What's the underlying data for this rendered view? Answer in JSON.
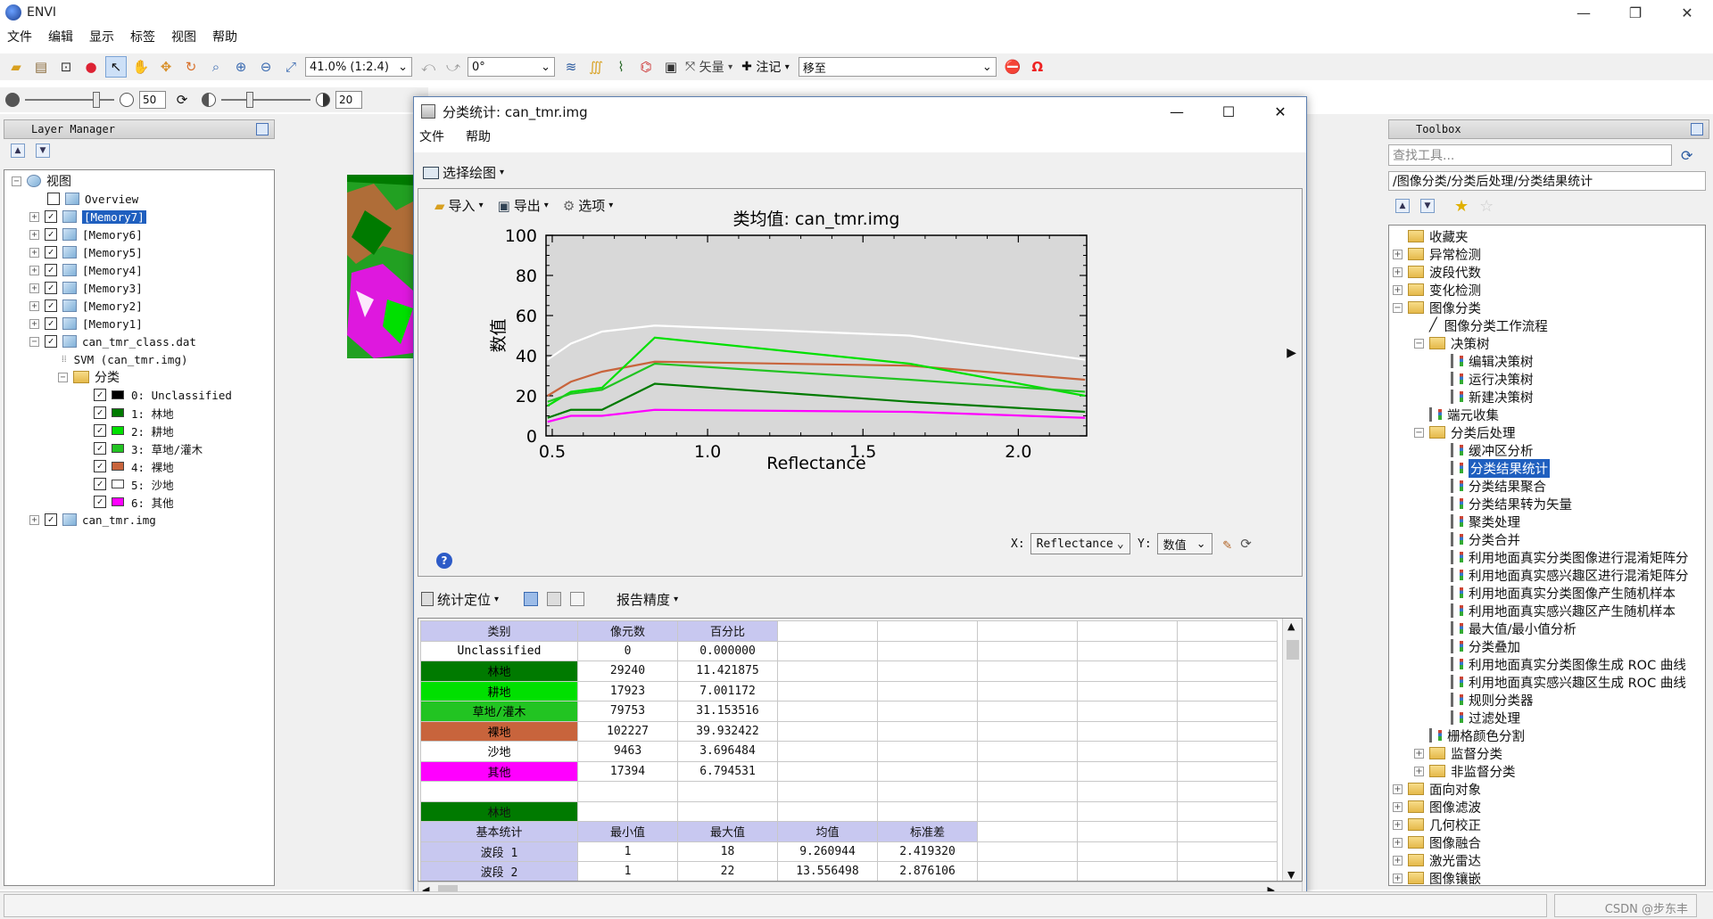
{
  "app": {
    "title": "ENVI",
    "menu": [
      "文件",
      "编辑",
      "显示",
      "标签",
      "视图",
      "帮助"
    ]
  },
  "toolbar": {
    "zoom": "41.0% (1:2.4)",
    "rotation": "0°",
    "vector_label": "矢量",
    "annotate_label": "注记",
    "goto_value": "移至",
    "brightness": "50",
    "contrast": "20"
  },
  "layer_manager": {
    "title": "Layer Manager",
    "root": "视图",
    "items": [
      {
        "label": "Overview",
        "checked": false
      },
      {
        "label": "[Memory7]",
        "checked": true,
        "selected": true
      },
      {
        "label": "[Memory6]",
        "checked": true
      },
      {
        "label": "[Memory5]",
        "checked": true
      },
      {
        "label": "[Memory4]",
        "checked": true
      },
      {
        "label": "[Memory3]",
        "checked": true
      },
      {
        "label": "[Memory2]",
        "checked": true
      },
      {
        "label": "[Memory1]",
        "checked": true
      },
      {
        "label": "can_tmr_class.dat",
        "checked": true
      }
    ],
    "svm_label": "SVM (can_tmr.img)",
    "class_folder": "分类",
    "classes": [
      {
        "label": "0: Unclassified",
        "color": "#000000"
      },
      {
        "label": "1: 林地",
        "color": "#007a00"
      },
      {
        "label": "2: 耕地",
        "color": "#00e000"
      },
      {
        "label": "3: 草地/灌木",
        "color": "#22c422"
      },
      {
        "label": "4: 裸地",
        "color": "#c8643c"
      },
      {
        "label": "5: 沙地",
        "color": "#ffffff"
      },
      {
        "label": "6: 其他",
        "color": "#ff00ff"
      }
    ],
    "last_item": "can_tmr.img"
  },
  "dialog": {
    "title": "分类统计: can_tmr.img",
    "menu": [
      "文件",
      "帮助"
    ],
    "select_plot": "选择绘图",
    "plot_toolbar": {
      "import": "导入",
      "export": "导出",
      "options": "选项"
    },
    "x_axis_label": "X:",
    "x_axis_value": "Reflectance",
    "y_axis_label": "Y:",
    "y_axis_value": "数值",
    "stats_toolbar": {
      "locate": "统计定位",
      "precision": "报告精度"
    }
  },
  "chart_data": {
    "type": "line",
    "title": "类均值: can_tmr.img",
    "xlabel": "Reflectance",
    "ylabel": "数值",
    "xlim": [
      0.48,
      2.22
    ],
    "ylim": [
      0,
      100
    ],
    "xticks": [
      "0.5",
      "1.0",
      "1.5",
      "2.0"
    ],
    "yticks": [
      "0",
      "20",
      "40",
      "60",
      "80",
      "100"
    ],
    "x": [
      0.485,
      0.56,
      0.66,
      0.83,
      1.65,
      2.215
    ],
    "series": [
      {
        "color": "#ffffff",
        "values": [
          38,
          46,
          52,
          55,
          50,
          38
        ]
      },
      {
        "color": "#c8643c",
        "values": [
          20,
          27,
          32,
          37,
          35,
          28
        ]
      },
      {
        "color": "#00e000",
        "values": [
          15,
          22,
          24,
          49,
          36,
          20
        ]
      },
      {
        "color": "#22c422",
        "values": [
          17,
          21,
          23,
          36,
          28,
          22
        ]
      },
      {
        "color": "#007a00",
        "values": [
          9,
          13,
          13,
          26,
          17,
          12
        ]
      },
      {
        "color": "#ff00ff",
        "values": [
          7,
          10,
          10,
          13,
          12,
          9
        ]
      }
    ]
  },
  "stats_table": {
    "headers": [
      "类别",
      "像元数",
      "百分比"
    ],
    "rows": [
      {
        "name": "Unclassified",
        "pixels": "0",
        "percent": "0.000000",
        "bg": "#ffffff",
        "fg": "#000000"
      },
      {
        "name": "林地",
        "pixels": "29240",
        "percent": "11.421875",
        "bg": "#007a00",
        "fg": "#000000"
      },
      {
        "name": "耕地",
        "pixels": "17923",
        "percent": "7.001172",
        "bg": "#00e000",
        "fg": "#000000"
      },
      {
        "name": "草地/灌木",
        "pixels": "79753",
        "percent": "31.153516",
        "bg": "#22c422",
        "fg": "#000000"
      },
      {
        "name": "裸地",
        "pixels": "102227",
        "percent": "39.932422",
        "bg": "#c8643c",
        "fg": "#000000"
      },
      {
        "name": "沙地",
        "pixels": "9463",
        "percent": "3.696484",
        "bg": "#ffffff",
        "fg": "#000000"
      },
      {
        "name": "其他",
        "pixels": "17394",
        "percent": "6.794531",
        "bg": "#ff00ff",
        "fg": "#000000"
      }
    ],
    "class_section_title": "林地",
    "basic_headers": [
      "基本统计",
      "最小值",
      "最大值",
      "均值",
      "标准差"
    ],
    "basic_rows": [
      [
        "波段 1",
        "1",
        "18",
        "9.260944",
        "2.419320"
      ],
      [
        "波段 2",
        "1",
        "22",
        "13.556498",
        "2.876106"
      ]
    ]
  },
  "toolbox": {
    "title": "Toolbox",
    "search_placeholder": "查找工具...",
    "path": "/图像分类/分类后处理/分类结果统计",
    "tree": [
      {
        "label": "收藏夹",
        "level": 0,
        "type": "folder",
        "exp": ""
      },
      {
        "label": "异常检测",
        "level": 0,
        "type": "folder",
        "exp": "+"
      },
      {
        "label": "波段代数",
        "level": 0,
        "type": "folder",
        "exp": "+"
      },
      {
        "label": "变化检测",
        "level": 0,
        "type": "folder",
        "exp": "+"
      },
      {
        "label": "图像分类",
        "level": 0,
        "type": "folder",
        "exp": "-"
      },
      {
        "label": "图像分类工作流程",
        "level": 1,
        "type": "wand",
        "exp": ""
      },
      {
        "label": "决策树",
        "level": 1,
        "type": "folder",
        "exp": "-"
      },
      {
        "label": "编辑决策树",
        "level": 2,
        "type": "tool",
        "exp": ""
      },
      {
        "label": "运行决策树",
        "level": 2,
        "type": "tool",
        "exp": ""
      },
      {
        "label": "新建决策树",
        "level": 2,
        "type": "tool",
        "exp": ""
      },
      {
        "label": "端元收集",
        "level": 1,
        "type": "tool",
        "exp": ""
      },
      {
        "label": "分类后处理",
        "level": 1,
        "type": "folder",
        "exp": "-"
      },
      {
        "label": "缓冲区分析",
        "level": 2,
        "type": "tool",
        "exp": ""
      },
      {
        "label": "分类结果统计",
        "level": 2,
        "type": "tool",
        "exp": "",
        "selected": true
      },
      {
        "label": "分类结果聚合",
        "level": 2,
        "type": "tool",
        "exp": ""
      },
      {
        "label": "分类结果转为矢量",
        "level": 2,
        "type": "tool",
        "exp": ""
      },
      {
        "label": "聚类处理",
        "level": 2,
        "type": "tool",
        "exp": ""
      },
      {
        "label": "分类合并",
        "level": 2,
        "type": "tool",
        "exp": ""
      },
      {
        "label": "利用地面真实分类图像进行混淆矩阵分",
        "level": 2,
        "type": "tool",
        "exp": ""
      },
      {
        "label": "利用地面真实感兴趣区进行混淆矩阵分",
        "level": 2,
        "type": "tool",
        "exp": ""
      },
      {
        "label": "利用地面真实分类图像产生随机样本",
        "level": 2,
        "type": "tool",
        "exp": ""
      },
      {
        "label": "利用地面真实感兴趣区产生随机样本",
        "level": 2,
        "type": "tool",
        "exp": ""
      },
      {
        "label": "最大值/最小值分析",
        "level": 2,
        "type": "tool",
        "exp": ""
      },
      {
        "label": "分类叠加",
        "level": 2,
        "type": "tool",
        "exp": ""
      },
      {
        "label": "利用地面真实分类图像生成 ROC 曲线",
        "level": 2,
        "type": "tool",
        "exp": ""
      },
      {
        "label": "利用地面真实感兴趣区生成 ROC 曲线",
        "level": 2,
        "type": "tool",
        "exp": ""
      },
      {
        "label": "规则分类器",
        "level": 2,
        "type": "tool",
        "exp": ""
      },
      {
        "label": "过滤处理",
        "level": 2,
        "type": "tool",
        "exp": ""
      },
      {
        "label": "栅格颜色分割",
        "level": 1,
        "type": "tool",
        "exp": ""
      },
      {
        "label": "监督分类",
        "level": 1,
        "type": "folder",
        "exp": "+"
      },
      {
        "label": "非监督分类",
        "level": 1,
        "type": "folder",
        "exp": "+"
      },
      {
        "label": "面向对象",
        "level": 0,
        "type": "folder",
        "exp": "+"
      },
      {
        "label": "图像滤波",
        "level": 0,
        "type": "folder",
        "exp": "+"
      },
      {
        "label": "几何校正",
        "level": 0,
        "type": "folder",
        "exp": "+"
      },
      {
        "label": "图像融合",
        "level": 0,
        "type": "folder",
        "exp": "+"
      },
      {
        "label": "激光雷达",
        "level": 0,
        "type": "folder",
        "exp": "+"
      },
      {
        "label": "图像镶嵌",
        "level": 0,
        "type": "folder",
        "exp": "+"
      }
    ]
  },
  "status": {
    "watermark": "CSDN @步东丰"
  }
}
